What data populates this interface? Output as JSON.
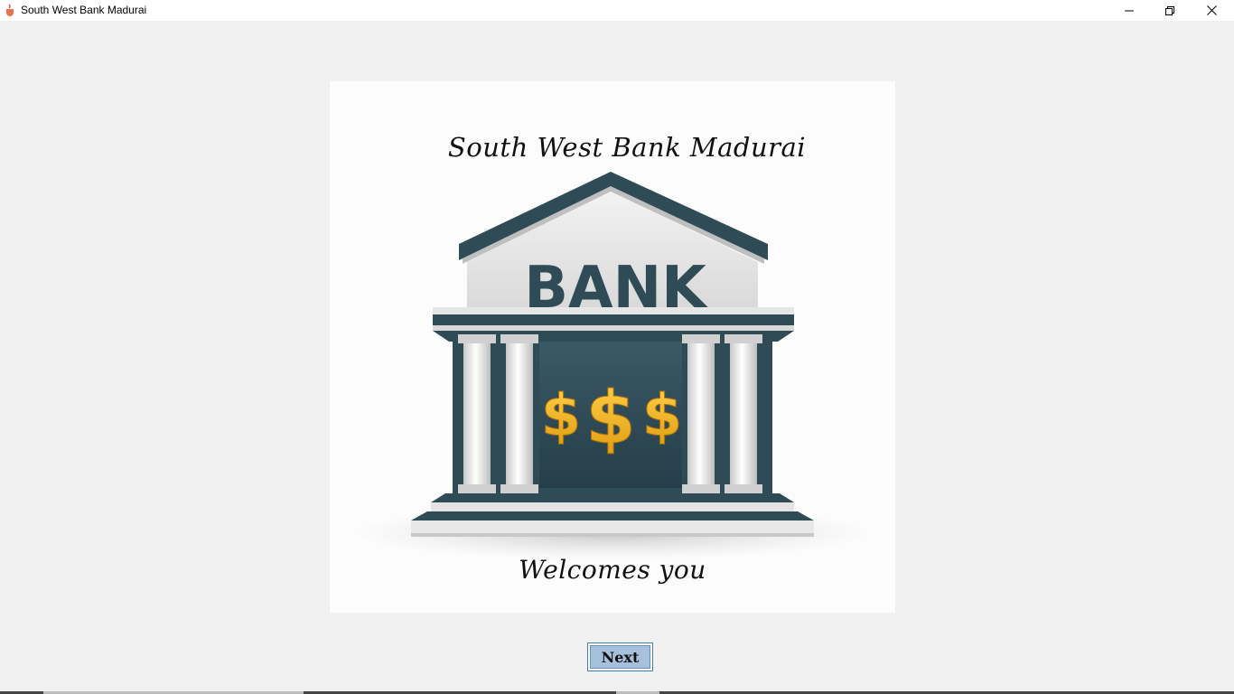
{
  "window": {
    "title": "South West Bank Madurai",
    "controls": {
      "minimize": "minimize-icon",
      "maximize": "restore-icon",
      "close": "close-icon"
    }
  },
  "splash": {
    "heading": "South West Bank Madurai",
    "building_sign": "BANK",
    "currency_symbols": [
      "$",
      "$",
      "$"
    ],
    "tagline": "Welcomes you"
  },
  "actions": {
    "next_label": "Next"
  },
  "colors": {
    "background": "#f0f0f0",
    "building_dark": "#2f4b56",
    "dollar_gold": "#f2b21c",
    "button_fill": "#a7c0db",
    "button_border": "#3c7fb1"
  }
}
